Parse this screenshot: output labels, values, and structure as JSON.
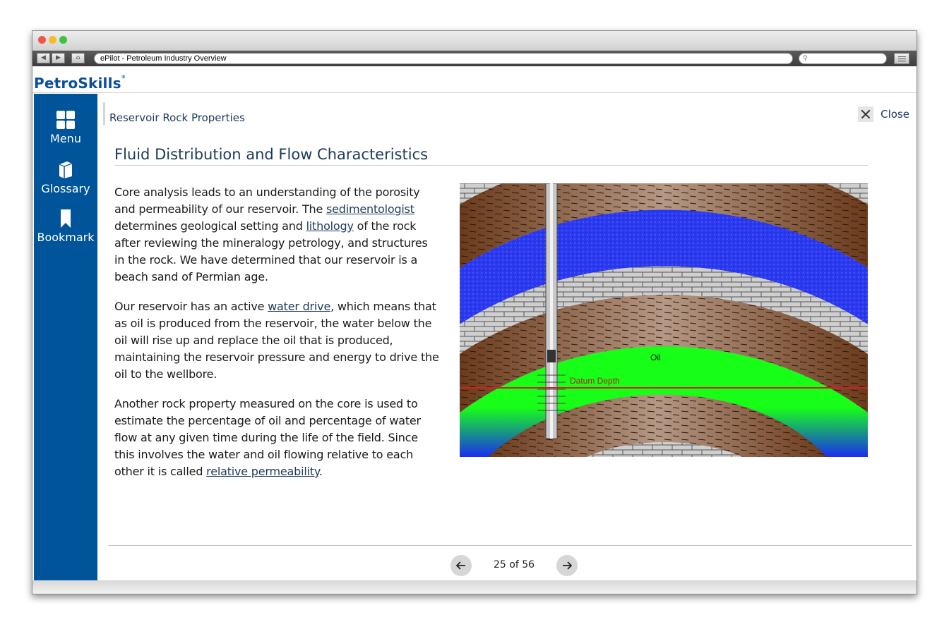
{
  "browser": {
    "url_title": "ePilot - Petroleum Industry Overview",
    "search_placeholder": ""
  },
  "brand": {
    "logo_text": "PetroSkills",
    "logo_mark": "®"
  },
  "sidebar": {
    "items": [
      {
        "label": "Menu",
        "icon": "grid-icon"
      },
      {
        "label": "Glossary",
        "icon": "book-icon"
      },
      {
        "label": "Bookmark",
        "icon": "bookmark-icon"
      }
    ]
  },
  "header": {
    "breadcrumb": "Reservoir Rock Properties",
    "close_label": "Close"
  },
  "main": {
    "title": "Fluid Distribution and Flow Characteristics",
    "p1": {
      "t1": "Core analysis leads to an understanding of the porosity and permeability of our reservoir. The ",
      "link1": "sedimentologist",
      "t2": " determines geological setting and ",
      "link2": "lithology",
      "t3": " of the rock after reviewing the mineralogy petrology, and structures in the rock. We have determined that our reservoir is a beach sand of Permian age."
    },
    "p2": {
      "t1": "Our reservoir has an active ",
      "link1": "water drive",
      "t2": ", which means that as oil is produced from the reservoir, the water below the oil will rise up and replace the oil that is produced, maintaining the reservoir pressure and energy to drive the oil to the wellbore."
    },
    "p3": {
      "t1": "Another rock property measured on the core is used to estimate the percentage of oil and percentage of water flow at any given time during the life of the field. Since this involves the water and oil flowing relative to each other it is called ",
      "link1": "relative permeability",
      "t2": "."
    },
    "figure": {
      "oil_label": "Oil",
      "datum_label": "Datum Depth",
      "colors": {
        "shale": "#6b3a1b",
        "shale_light": "#b08f78",
        "limestone": "#cfcfcf",
        "water_sand": "#1a2ef0",
        "oil": "#17ff17",
        "datum": "#cc2222"
      }
    }
  },
  "pager": {
    "text": "25 of 56",
    "prev_icon": "arrow-left-icon",
    "next_icon": "arrow-right-icon"
  },
  "colors": {
    "sidebar": "#00549a",
    "accent_text": "#1d3a5a"
  }
}
